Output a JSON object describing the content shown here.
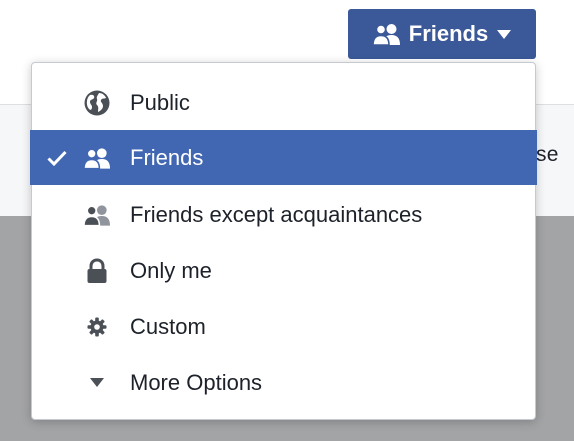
{
  "audience_button": {
    "label": "Friends",
    "icon": "friends-icon",
    "caret": "caret-down-icon"
  },
  "background": {
    "peek_text": "ose"
  },
  "menu": {
    "items": [
      {
        "label": "Public",
        "icon": "globe-icon",
        "selected": false
      },
      {
        "label": "Friends",
        "icon": "friends-icon",
        "selected": true
      },
      {
        "label": "Friends except acquaintances",
        "icon": "friends-except-icon",
        "selected": false
      },
      {
        "label": "Only me",
        "icon": "lock-icon",
        "selected": false
      },
      {
        "label": "Custom",
        "icon": "gear-icon",
        "selected": false
      },
      {
        "label": "More Options",
        "icon": "caret-down-icon",
        "selected": false
      }
    ]
  },
  "colors": {
    "brand": "#3b5998",
    "selected": "#4267b2",
    "icon": "#4b4f56"
  }
}
